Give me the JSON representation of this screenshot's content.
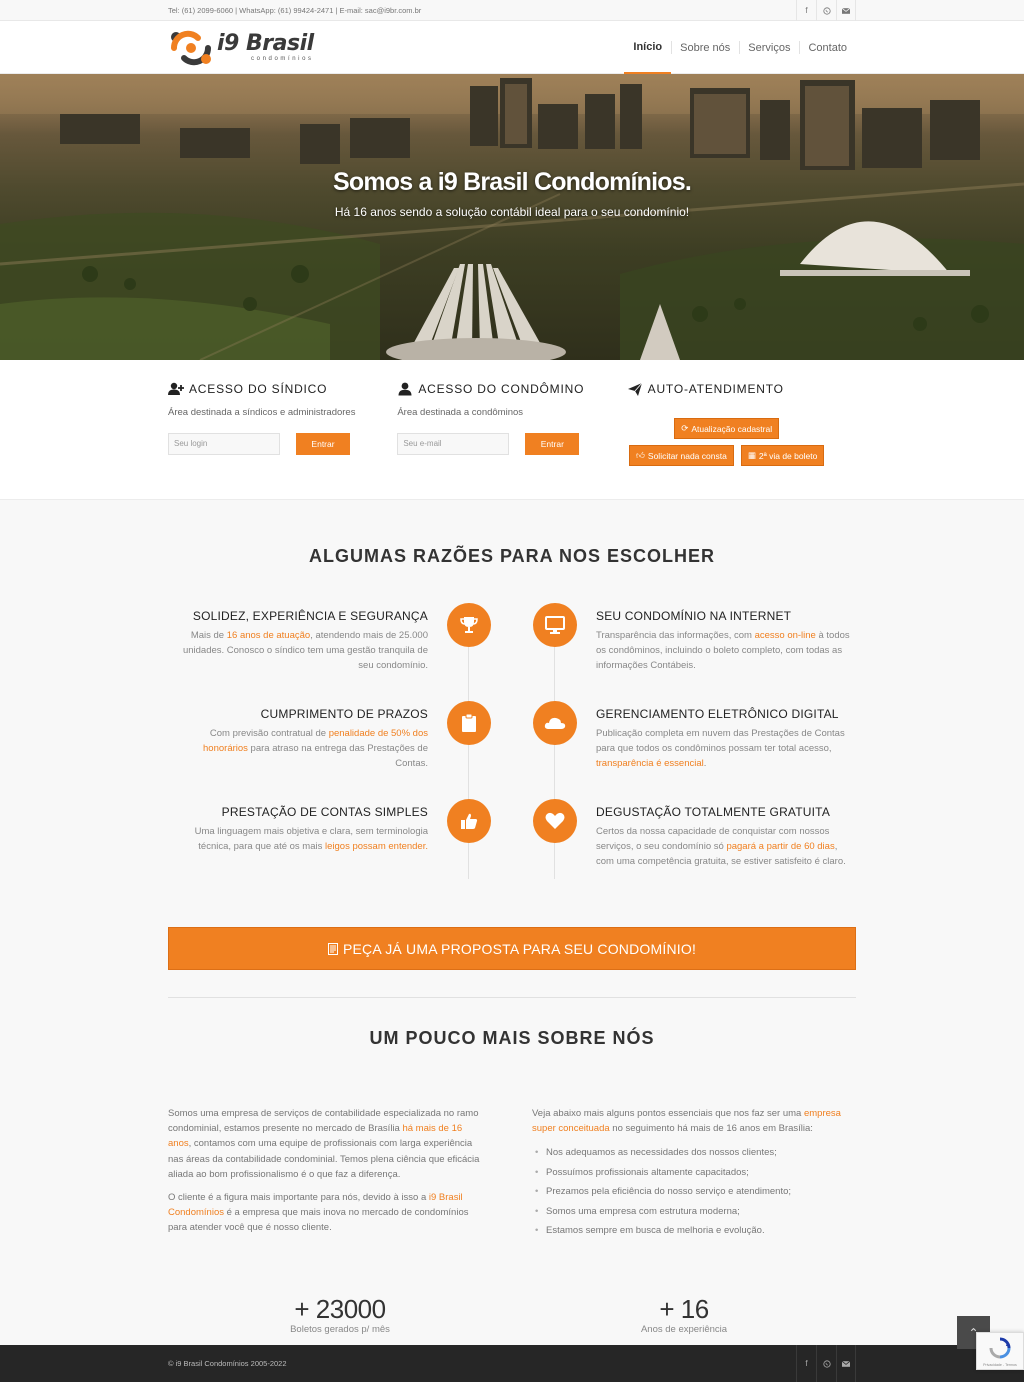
{
  "topbar": {
    "info": "Tel: (61) 2099-6060 | WhatsApp: (61) 99424-2471 | E-mail: sac@i9br.com.br",
    "socials": [
      "facebook-icon",
      "whatsapp-icon",
      "mail-icon"
    ]
  },
  "logo": {
    "name": "i9 Brasil",
    "sub": "condomínios"
  },
  "nav": [
    {
      "label": "Início",
      "active": true
    },
    {
      "label": "Sobre nós"
    },
    {
      "label": "Serviços"
    },
    {
      "label": "Contato"
    }
  ],
  "hero": {
    "title": "Somos a i9 Brasil Condomínios.",
    "subtitle": "Há 16 anos sendo a solução contábil ideal para o seu condomínio!"
  },
  "access": {
    "sindico": {
      "title": "ACESSO DO SÍNDICO",
      "desc": "Área destinada a síndicos e administradores",
      "placeholder": "Seu login",
      "button": "Entrar"
    },
    "condomino": {
      "title": "ACESSO DO CONDÔMINO",
      "desc": "Área destinada a condôminos",
      "placeholder": "Seu e-mail",
      "button": "Entrar"
    },
    "auto": {
      "title": "AUTO-ATENDIMENTO",
      "btn_update": "Atualização cadastral",
      "btn_nada": "Solicitar nada consta",
      "btn_boleto": "2ª via de boleto"
    }
  },
  "reasons": {
    "title": "ALGUMAS RAZÕES PARA NOS ESCOLHER",
    "items": [
      {
        "title": "SOLIDEZ, EXPERIÊNCIA E SEGURANÇA",
        "p1": "Mais de ",
        "hl": "16 anos de atuação",
        "p2": ", atendendo mais de 25.000 unidades. Conosco o síndico tem uma gestão tranquila de seu condomínio.",
        "icon": "trophy-icon"
      },
      {
        "title": "SEU CONDOMÍNIO NA INTERNET",
        "p1": "Transparência das informações, com ",
        "hl": "acesso on-line",
        "p2": " à todos os condôminos, incluindo o boleto completo, com todas as informações Contábeis.",
        "icon": "monitor-icon"
      },
      {
        "title": "CUMPRIMENTO DE PRAZOS",
        "p1": "Com previsão contratual de ",
        "hl": "penalidade de 50% dos honorários",
        "p2": " para atraso na entrega das Prestações de Contas.",
        "icon": "clipboard-icon"
      },
      {
        "title": "GERENCIAMENTO ELETRÔNICO DIGITAL",
        "p1": "Publicação completa em nuvem das Prestações de Contas para que todos os condôminos possam ter total acesso, ",
        "hl": "transparência é essencial",
        "p2": ".",
        "icon": "cloud-icon"
      },
      {
        "title": "PRESTAÇÃO DE CONTAS SIMPLES",
        "p1": "Uma linguagem mais objetiva e clara, sem terminologia técnica, para que até os mais ",
        "hl": "leigos possam entender.",
        "p2": "",
        "icon": "thumbs-up-icon"
      },
      {
        "title": "DEGUSTAÇÃO TOTALMENTE GRATUITA",
        "p1": "Certos da nossa capacidade de conquistar com nossos serviços, o seu condomínio só ",
        "hl": "pagará a partir de 60 dias",
        "p2": ", com uma competência gratuita, se estiver satisfeito é claro.",
        "icon": "heart-icon"
      }
    ],
    "cta": "PEÇA JÁ UMA PROPOSTA PARA SEU CONDOMÍNIO!"
  },
  "about": {
    "title": "UM POUCO MAIS SOBRE NÓS",
    "left_p1a": "Somos uma empresa de serviços de contabilidade especializada no ramo condominial, estamos presente no mercado de Brasília ",
    "left_p1hl": "há mais de 16 anos",
    "left_p1b": ", contamos com uma equipe de profissionais com larga experiência nas áreas da contabilidade condominial. Temos plena ciência que eficácia aliada ao bom profissionalismo é o que faz a diferença.",
    "left_p2a": "O cliente é a figura mais importante para nós, devido à isso a ",
    "left_p2hl": "i9 Brasil Condomínios",
    "left_p2b": " é a empresa que mais inova no mercado de condomínios para atender você que é nosso cliente.",
    "right_pa": "Veja abaixo mais alguns pontos essenciais que nos faz ser uma ",
    "right_phl": "empresa super conceituada",
    "right_pb": " no seguimento há mais de 16 anos em Brasília:",
    "list": [
      "Nos adequamos as necessidades dos nossos clientes;",
      "Possuímos profissionais altamente capacitados;",
      "Prezamos pela eficiência do nosso serviço e atendimento;",
      "Somos uma empresa com estrutura moderna;",
      "Estamos sempre em busca de melhoria e evolução."
    ]
  },
  "stats": [
    {
      "num": "+ 23000",
      "label": "Boletos gerados p/ mês"
    },
    {
      "num": "+ 16",
      "label": "Anos de experiência"
    }
  ],
  "footer": {
    "copy": "© i9 Brasil Condomínios 2005-2022"
  },
  "recaptcha": {
    "terms": "Privacidade - Termos"
  },
  "colors": {
    "accent": "#f08021",
    "footer": "#262626"
  }
}
